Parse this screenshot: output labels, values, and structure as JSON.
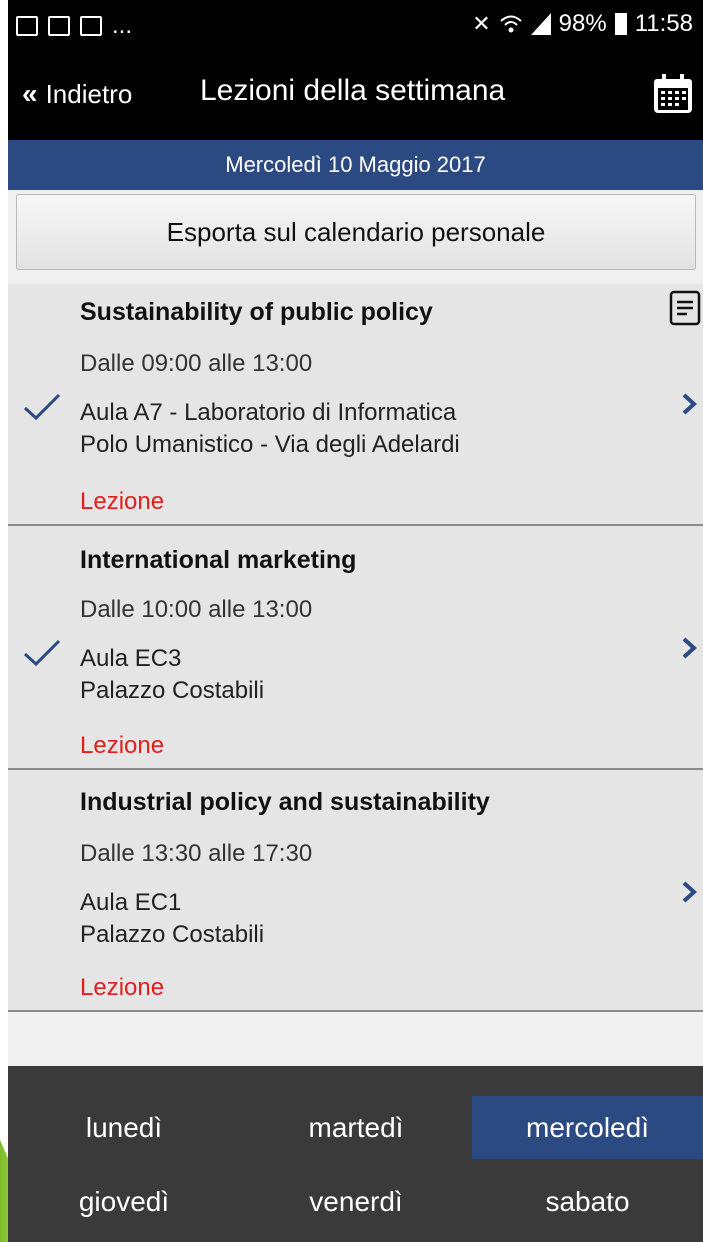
{
  "status_bar": {
    "left_icons": [
      "gmail-icon",
      "image-icon",
      "gmail-icon"
    ],
    "ellipsis": "...",
    "battery": "98%",
    "time": "11:58"
  },
  "header": {
    "back_label": "Indietro",
    "title": "Lezioni della settimana"
  },
  "date_bar": "Mercoledì 10 Maggio 2017",
  "export_button": "Esporta sul calendario personale",
  "lessons": [
    {
      "title": "Sustainability of public policy",
      "time": "Dalle 09:00 alle 13:00",
      "room": "Aula A7 - Laboratorio di Informatica",
      "place": "Polo Umanistico - Via degli Adelardi",
      "type": "Lezione",
      "checked": true
    },
    {
      "title": "International marketing",
      "time": "Dalle 10:00 alle 13:00",
      "room": "Aula EC3",
      "place": "Palazzo Costabili",
      "type": "Lezione",
      "checked": true
    },
    {
      "title": "Industrial policy and sustainability",
      "time": "Dalle 13:30 alle 17:30",
      "room": "Aula EC1",
      "place": "Palazzo Costabili",
      "type": "Lezione",
      "checked": false
    }
  ],
  "tabs": [
    "lunedì",
    "martedì",
    "mercoledì",
    "giovedì",
    "venerdì",
    "sabato"
  ],
  "active_tab": "mercoledì",
  "colors": {
    "accent": "#2c4a82",
    "lesson_type": "#e0201c"
  }
}
